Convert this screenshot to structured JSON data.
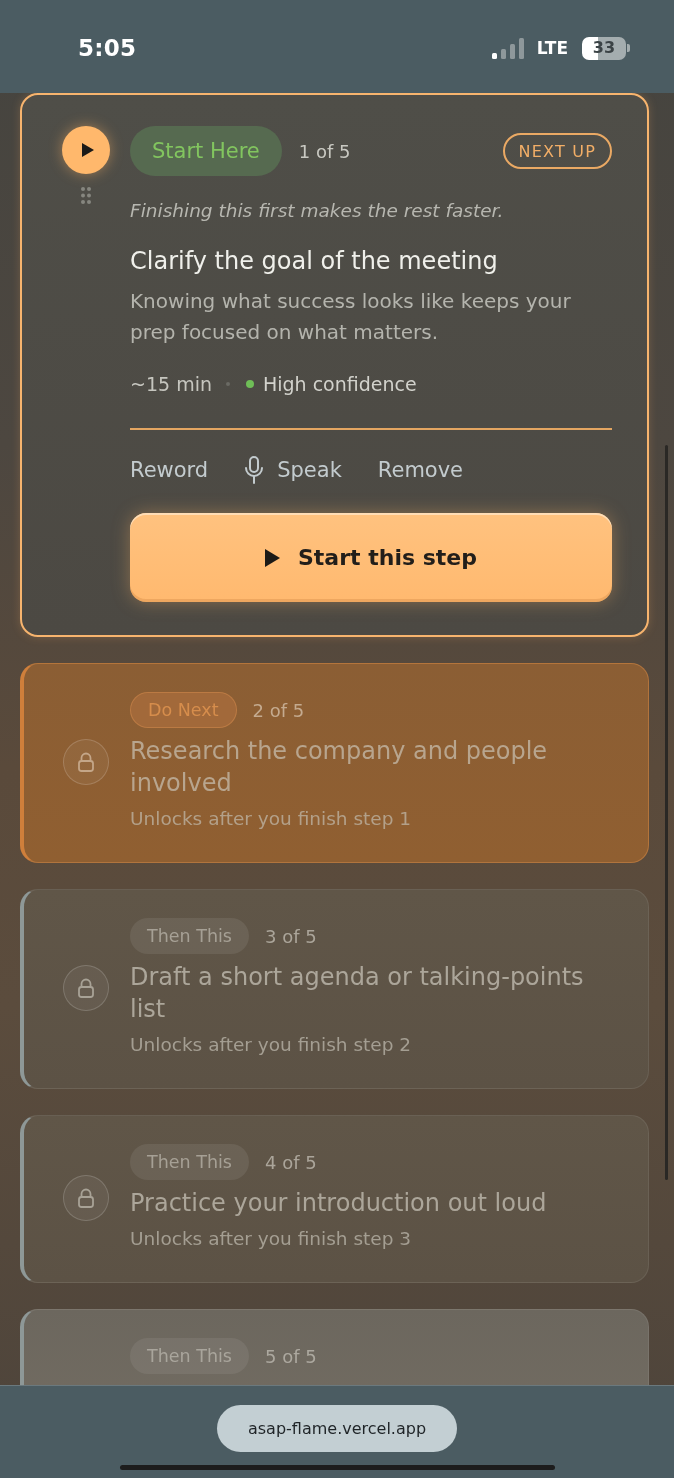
{
  "status_bar": {
    "time": "5:05",
    "network": "LTE",
    "battery": "33"
  },
  "steps": [
    {
      "kind": "current",
      "badge": "Start Here",
      "position": "1 of 5",
      "tag": "NEXT UP",
      "note": "Finishing this first makes the rest faster.",
      "title": "Clarify the goal of the meeting",
      "description": "Knowing what success looks like keeps your prep focused on what matters.",
      "duration": "~15 min",
      "confidence": "High confidence",
      "actions": [
        {
          "kind": "text",
          "label": "Reword"
        },
        {
          "kind": "voice",
          "label": "Speak"
        },
        {
          "kind": "text",
          "label": "Remove"
        }
      ],
      "button": "Start this step"
    },
    {
      "kind": "next",
      "badge": "Do Next",
      "position": "2 of 5",
      "title": "Research the company and people involved",
      "subtitle": "Unlocks after you finish step 1"
    },
    {
      "kind": "later",
      "badge": "Then This",
      "position": "3 of 5",
      "title": "Draft a short agenda or talking-points list",
      "subtitle": "Unlocks after you finish step 2"
    },
    {
      "kind": "later",
      "badge": "Then This",
      "position": "4 of 5",
      "title": "Practice your introduction out loud",
      "subtitle": "Unlocks after you finish step 3"
    },
    {
      "kind": "later",
      "badge": "Then This",
      "position": "5 of 5"
    }
  ],
  "address_bar": {
    "url": "asap-flame.vercel.app"
  }
}
